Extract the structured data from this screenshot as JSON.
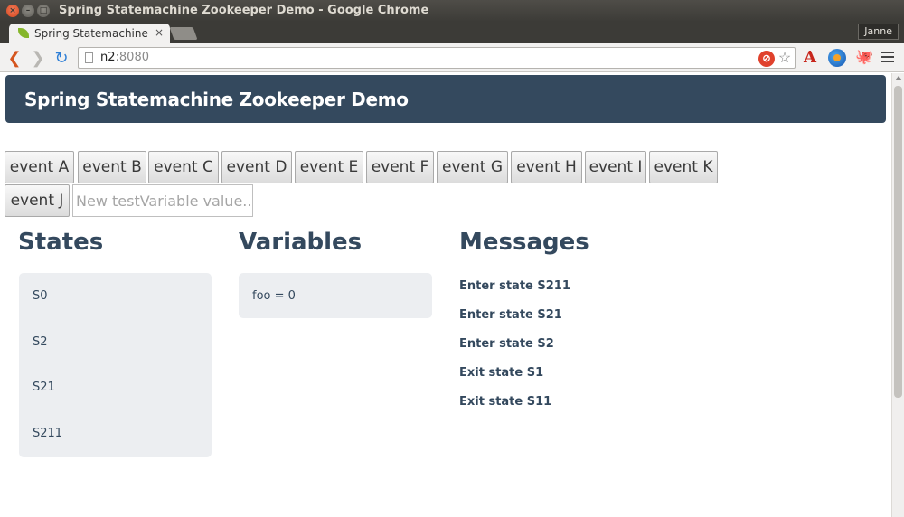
{
  "window": {
    "title": "Spring Statemachine Zookeeper Demo - Google Chrome",
    "controls": {
      "close": "×",
      "minimize": "–",
      "maximize": "□"
    }
  },
  "browser": {
    "tab_label": "Spring Statemachine Zookeeper Demo",
    "tab_close": "×",
    "profile_name": "Janne",
    "url_host": "n2",
    "url_port": ":8080",
    "nav": {
      "back": "❮",
      "forward": "❯",
      "reload": "↻"
    },
    "extensions": {
      "adblock": "⊘",
      "star": "☆",
      "acrobat": "A",
      "octocat": "🐙"
    }
  },
  "page": {
    "brand": "Spring Statemachine Zookeeper Demo",
    "event_buttons": [
      "event A",
      "event B",
      "event C",
      "event D",
      "event E",
      "event F",
      "event G",
      "event H",
      "event I",
      "event K",
      "event J"
    ],
    "test_input": {
      "placeholder": "New testVariable value...",
      "value": ""
    },
    "states": {
      "heading": "States",
      "items": [
        "S0",
        "S2",
        "S21",
        "S211"
      ]
    },
    "variables": {
      "heading": "Variables",
      "items": [
        "foo = 0"
      ]
    },
    "messages": {
      "heading": "Messages",
      "items": [
        "Enter state S211",
        "Enter state S21",
        "Enter state S2",
        "Exit state S1",
        "Exit state S11"
      ]
    }
  },
  "colors": {
    "navbar": "#34495e",
    "text_primary": "#34495e",
    "well_bg": "#eceef1",
    "window_chrome": "#3c3b37"
  }
}
